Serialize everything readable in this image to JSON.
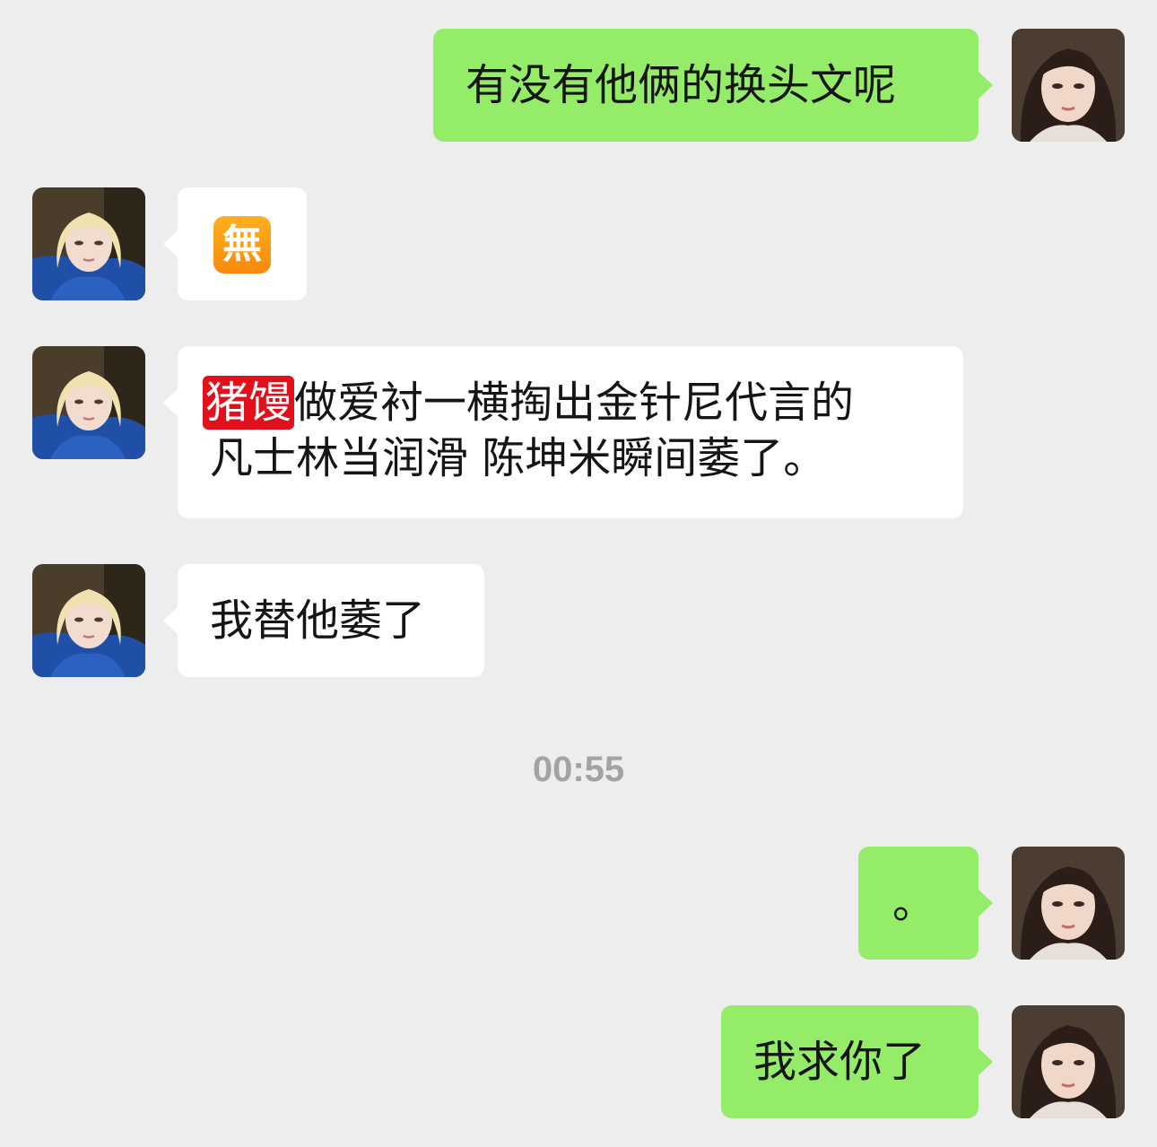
{
  "conversation": {
    "messages": [
      {
        "side": "right",
        "text": "有没有他俩的换头文呢",
        "avatar": "self-avatar"
      },
      {
        "side": "left",
        "emoji_text": "無",
        "emoji": "no-charge-emoji",
        "avatar": "contact-avatar"
      },
      {
        "side": "left",
        "tag": "猪馒",
        "line1": "做爱衬一横掏出金针尼代言的",
        "line2": "凡士林当润滑 陈坤米瞬间萎了。",
        "avatar": "contact-avatar"
      },
      {
        "side": "left",
        "text": "我替他萎了",
        "avatar": "contact-avatar"
      },
      {
        "timestamp": "00:55"
      },
      {
        "side": "right",
        "text": "。",
        "avatar": "self-avatar"
      },
      {
        "side": "right",
        "text": "我求你了",
        "avatar": "self-avatar"
      }
    ]
  },
  "colors": {
    "background": "#ededed",
    "sent_bubble": "#95ec69",
    "received_bubble": "#ffffff",
    "tag_red": "#e2101a",
    "timestamp_text": "#a3a3a3"
  }
}
